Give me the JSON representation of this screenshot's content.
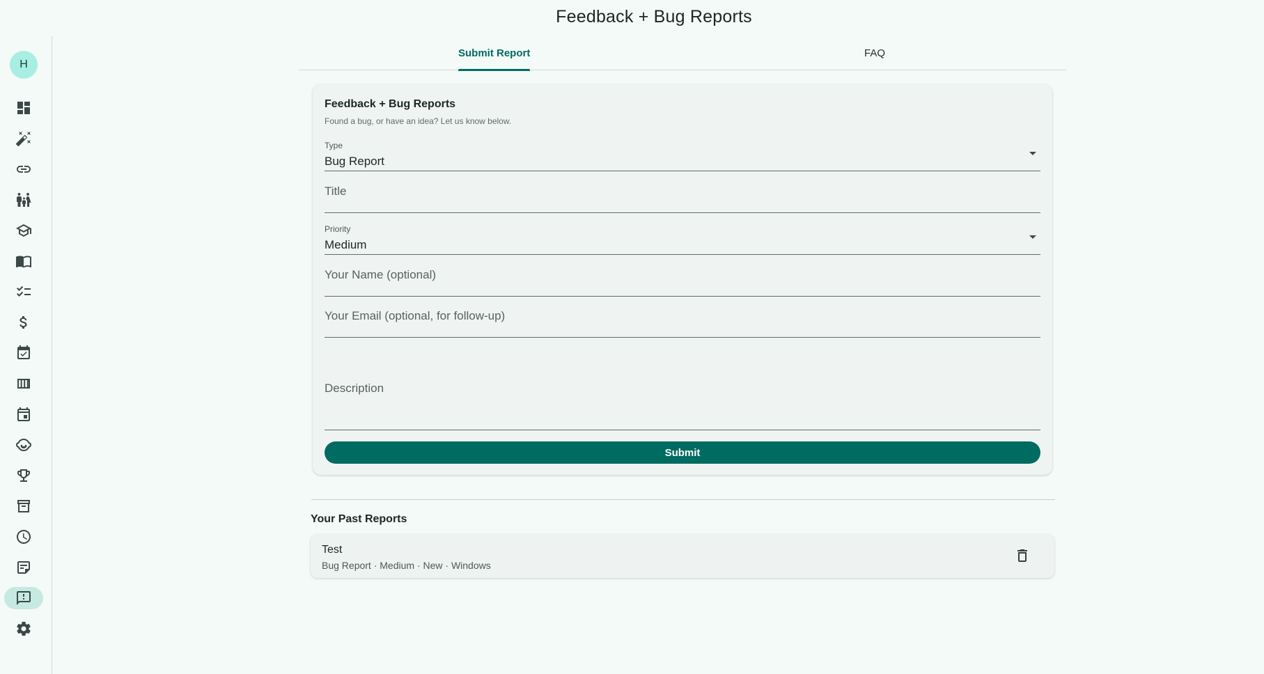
{
  "app": {
    "title": "Feedback + Bug Reports"
  },
  "sidebar": {
    "avatar_initial": "H",
    "items": [
      {
        "icon": "dashboard-icon"
      },
      {
        "icon": "magic-wand-icon"
      },
      {
        "icon": "link-icon"
      },
      {
        "icon": "family-icon"
      },
      {
        "icon": "school-icon"
      },
      {
        "icon": "book-icon"
      },
      {
        "icon": "checklist-icon"
      },
      {
        "icon": "dollar-icon"
      },
      {
        "icon": "event-available-icon"
      },
      {
        "icon": "view-columns-icon"
      },
      {
        "icon": "calendar-icon"
      },
      {
        "icon": "child-face-icon"
      },
      {
        "icon": "trophy-icon"
      },
      {
        "icon": "archive-icon"
      },
      {
        "icon": "clock-icon"
      },
      {
        "icon": "sticky-note-icon"
      },
      {
        "icon": "feedback-icon",
        "active": true
      },
      {
        "icon": "settings-icon"
      }
    ]
  },
  "tabs": [
    {
      "label": "Submit Report",
      "active": true
    },
    {
      "label": "FAQ",
      "active": false
    }
  ],
  "form": {
    "title": "Feedback + Bug Reports",
    "subtitle": "Found a bug, or have an idea? Let us know below.",
    "type": {
      "label": "Type",
      "value": "Bug Report"
    },
    "title_field": {
      "placeholder": "Title"
    },
    "priority": {
      "label": "Priority",
      "value": "Medium"
    },
    "name_field": {
      "placeholder": "Your Name (optional)"
    },
    "email_field": {
      "placeholder": "Your Email (optional, for follow-up)"
    },
    "description_field": {
      "placeholder": "Description"
    },
    "submit_label": "Submit"
  },
  "past_reports": {
    "heading": "Your Past Reports",
    "items": [
      {
        "title": "Test",
        "meta": "Bug Report · Medium · New · Windows"
      }
    ]
  },
  "colors": {
    "accent": "#006b61",
    "background": "#f3faf8",
    "avatar": "#a8eee2",
    "active_nav": "#c6e9e2"
  }
}
